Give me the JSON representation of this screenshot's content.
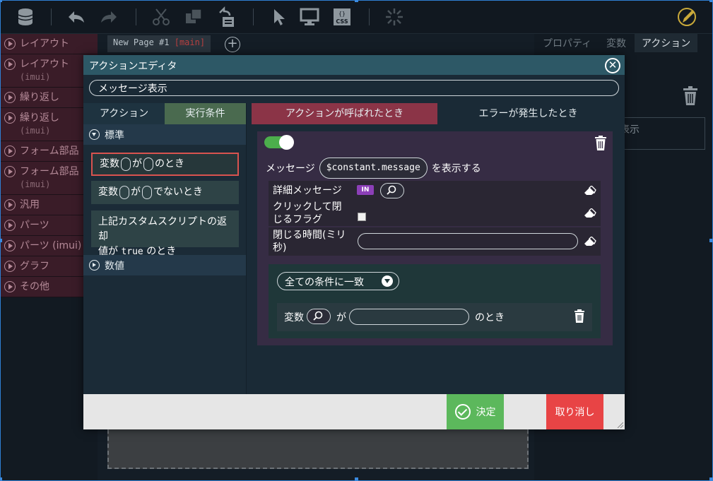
{
  "canvas": {
    "page_tab": "New Page #1",
    "page_branch": "[main]"
  },
  "left_panel": {
    "items": [
      {
        "label": "レイアウト",
        "sub": ""
      },
      {
        "label": "レイアウト",
        "sub": "(imui)"
      },
      {
        "label": "繰り返し",
        "sub": ""
      },
      {
        "label": "繰り返し",
        "sub": "(imui)"
      },
      {
        "label": "フォーム部品",
        "sub": ""
      },
      {
        "label": "フォーム部品",
        "sub": "(imui)"
      },
      {
        "label": "汎用",
        "sub": ""
      },
      {
        "label": "パーツ",
        "sub": ""
      },
      {
        "label": "パーツ (imui)",
        "sub": ""
      },
      {
        "label": "グラフ",
        "sub": ""
      },
      {
        "label": "その他",
        "sub": ""
      }
    ]
  },
  "right_panel": {
    "tabs": [
      "プロパティ",
      "変数",
      "アクション"
    ],
    "box_text": "表示"
  },
  "modal": {
    "title": "アクションエディタ",
    "action_name": "メッセージ表示",
    "left_tabs": [
      "アクション",
      "実行条件"
    ],
    "groups": {
      "standard": "標準",
      "numeric": "数値"
    },
    "conditions": {
      "c1_a": "変数",
      "c1_b": "が",
      "c1_c": "のとき",
      "c2_a": "変数",
      "c2_b": "が",
      "c2_c": "でないとき",
      "c3_line1": "上記カスタムスクリプトの返却",
      "c3_line2_a": "値が",
      "c3_line2_code": "true",
      "c3_line2_b": "のとき"
    },
    "right_tabs": [
      "アクションが呼ばれたとき",
      "エラーが発生したとき"
    ],
    "card": {
      "message_prefix": "メッセージ",
      "message_value": "$constant.message",
      "message_suffix": "を表示する",
      "detail_label": "詳細メッセージ",
      "in_badge": "IN",
      "click_close_line1": "クリックして閉",
      "click_close_line2": "じるフラグ",
      "close_time_line1": "閉じる時間(ミリ",
      "close_time_line2": "秒)",
      "match_select": "全ての条件に一致",
      "cond_var": "変数",
      "cond_ga": "が",
      "cond_toki": "のとき"
    },
    "footer": {
      "ok": "決定",
      "cancel": "取り消し"
    }
  },
  "colors": {
    "accent_green": "#5cb85c",
    "accent_red": "#e84445",
    "tab_active_red": "#8b3447",
    "modal_header": "#2d5866"
  }
}
